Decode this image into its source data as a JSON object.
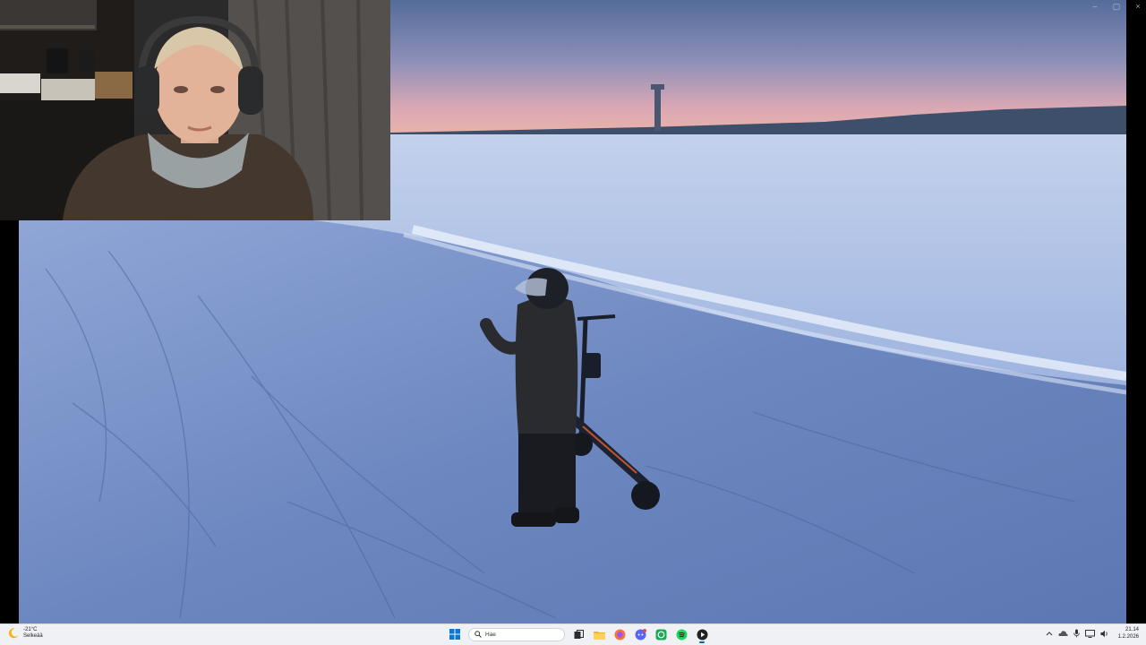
{
  "window": {
    "controls": [
      "minimize-icon",
      "maximize-icon",
      "close-icon"
    ]
  },
  "video": {
    "scene": "frozen-lake-dusk"
  },
  "webcam": {
    "subject": "person-with-headphones"
  },
  "taskbar": {
    "weather": {
      "temperature": "-21°C",
      "condition": "Selkeää",
      "icon": "moon-icon"
    },
    "search": {
      "placeholder": "Hae"
    },
    "apps": [
      "start-icon",
      "search-icon",
      "task-view-icon",
      "file-explorer-icon",
      "firefox-icon",
      "discord-icon",
      "whatsapp-icon",
      "spotify-icon",
      "media-player-icon"
    ],
    "tray_icons": [
      "chevron-up-icon",
      "onedrive-icon",
      "microphone-icon",
      "network-icon",
      "volume-icon"
    ],
    "clock": {
      "time": "21.14",
      "date": "1.2.2026"
    },
    "accent": "#0067c0"
  }
}
